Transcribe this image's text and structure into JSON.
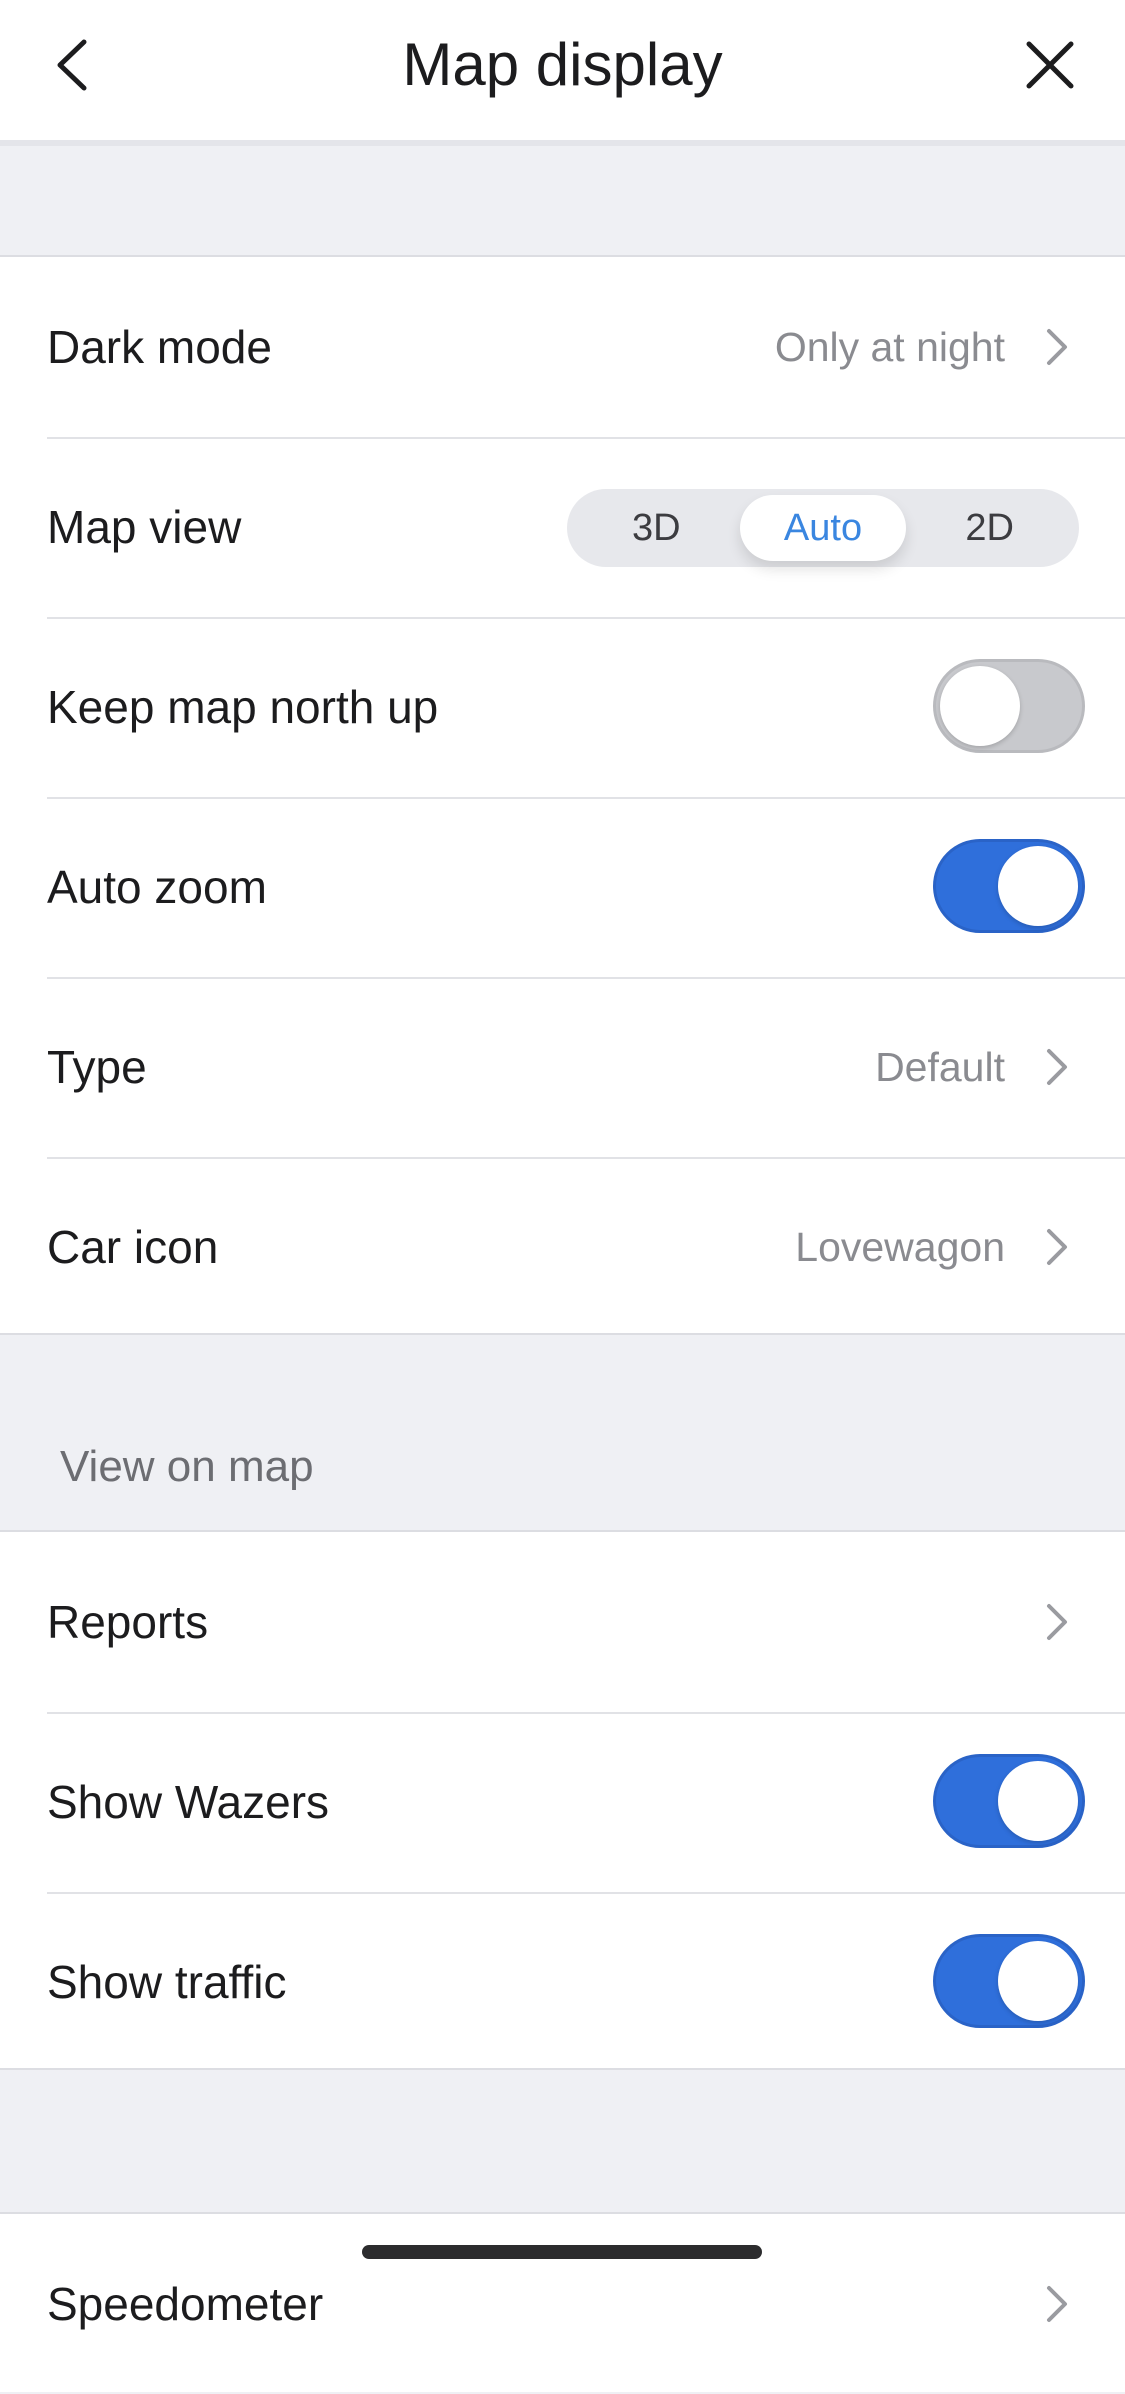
{
  "header": {
    "title": "Map display",
    "back_icon": "chevron-left-icon",
    "close_icon": "close-icon"
  },
  "general": {
    "dark_mode": {
      "label": "Dark mode",
      "value": "Only at night"
    },
    "map_view": {
      "label": "Map view",
      "options": [
        "3D",
        "Auto",
        "2D"
      ],
      "selected": "Auto"
    },
    "north_up": {
      "label": "Keep map north up",
      "on": false
    },
    "auto_zoom": {
      "label": "Auto zoom",
      "on": true
    },
    "type": {
      "label": "Type",
      "value": "Default"
    },
    "car_icon": {
      "label": "Car icon",
      "value": "Lovewagon"
    }
  },
  "view_on_map": {
    "title": "View on map",
    "reports": {
      "label": "Reports"
    },
    "show_wazers": {
      "label": "Show Wazers",
      "on": true
    },
    "show_traffic": {
      "label": "Show traffic",
      "on": true
    }
  },
  "more": {
    "speedometer": {
      "label": "Speedometer"
    }
  },
  "colors": {
    "accent": "#2f6fdb",
    "segment_active_text": "#3a86e0",
    "background": "#eff0f4"
  }
}
